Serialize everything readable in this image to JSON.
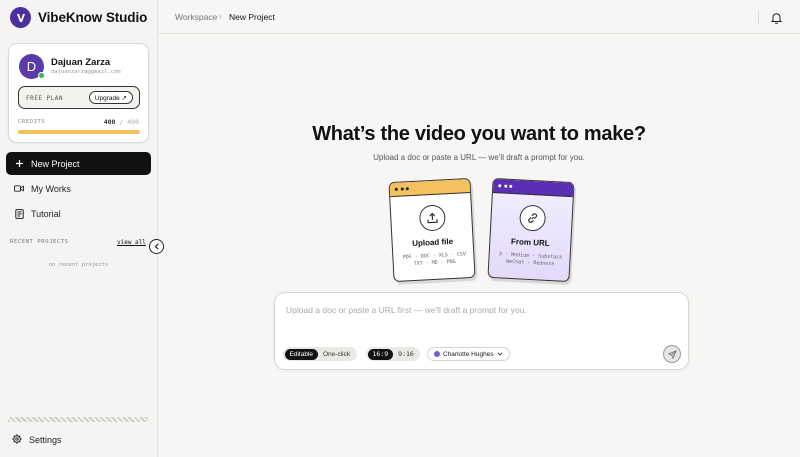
{
  "brand": {
    "name": "VibeKnow Studio",
    "logo_letter": "V"
  },
  "user": {
    "initial": "D",
    "name": "Dajuan Zarza",
    "email": "dajuanzarza@gmail.com",
    "plan_label": "FREE PLAN",
    "upgrade_label": "Upgrade ↗",
    "credits_label": "CREDITS",
    "credits_used": "400",
    "credits_sep": "/",
    "credits_max": "400",
    "credits_fraction": 1.0
  },
  "nav": {
    "new_project": "New Project",
    "my_works": "My Works",
    "tutorial": "Tutorial"
  },
  "recent": {
    "label": "RECENT PROJECTS",
    "view_all": "view all",
    "empty": "no recent projects"
  },
  "settings_label": "Settings",
  "breadcrumb": {
    "root": "Workspace",
    "sep": "›",
    "current": "New Project"
  },
  "main": {
    "headline": "What’s the video you want to make?",
    "subline": "Upload a doc or paste a URL — we’ll draft a prompt for you."
  },
  "cards": {
    "upload": {
      "title": "Upload file",
      "formats_1": "PDF · DOC · XLS · CSV",
      "formats_2": "TXT · MD · PNG"
    },
    "url": {
      "title": "From URL",
      "sources_1": "X · Medium · Substack",
      "sources_2": "WeChat · Rednote"
    }
  },
  "prompt": {
    "placeholder": "Upload a doc or paste a URL first — we'll draft a prompt for you.",
    "mode_editable": "Editable",
    "mode_oneclick": "One-click",
    "ratio_wide": "16:9",
    "ratio_tall": "9:16",
    "voice": "Charlotte Hughes"
  },
  "colors": {
    "accent_purple": "#5b2fb3",
    "accent_yellow": "#f3c25e",
    "online": "#2fb55c"
  }
}
